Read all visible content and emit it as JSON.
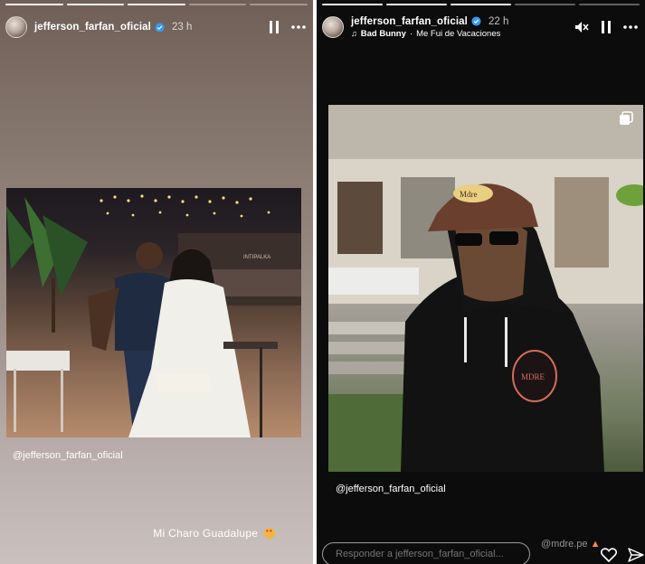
{
  "left_story": {
    "username": "jefferson_farfan_oficial",
    "time": "23 h",
    "photo_sign": "INTIPALKA",
    "mention": "@jefferson_farfan_oficial",
    "caption": "Mi Charo Guadalupe"
  },
  "right_story": {
    "username": "jefferson_farfan_oficial",
    "time": "22 h",
    "music_artist": "Bad Bunny",
    "music_separator": "·",
    "music_song": "Me Fui de Vacaciones",
    "cap_logo": "Mdre",
    "hoodie_logo": "MDRE",
    "mention": "@jefferson_farfan_oficial",
    "reply_placeholder": "Responder a jefferson_farfan_oficial...",
    "watermark": "@mdre.pe"
  },
  "icons": {
    "pause": "pause-icon",
    "more": "more-icon",
    "muted": "muted-speaker-icon",
    "verified": "verified-badge-icon",
    "like": "heart-icon",
    "share": "send-icon",
    "music": "music-note-icon",
    "carousel": "carousel-icon"
  },
  "colors": {
    "verified_blue": "#3897f0",
    "right_background": "#0c0c0c"
  }
}
